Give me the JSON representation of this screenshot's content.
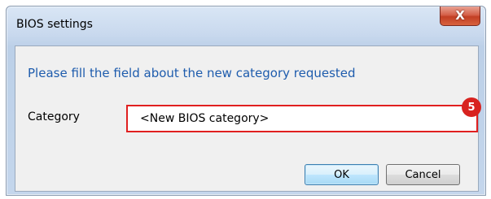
{
  "window": {
    "title": "BIOS settings",
    "close_glyph": "X"
  },
  "dialog": {
    "message": "Please fill the field about the new category requested",
    "category_label": "Category",
    "category_value": "<New BIOS category>",
    "callout_number": "5"
  },
  "buttons": {
    "ok_label": "OK",
    "cancel_label": "Cancel"
  },
  "colors": {
    "message_text": "#1e5cad",
    "highlight": "#e02020",
    "badge": "#d8231f"
  }
}
